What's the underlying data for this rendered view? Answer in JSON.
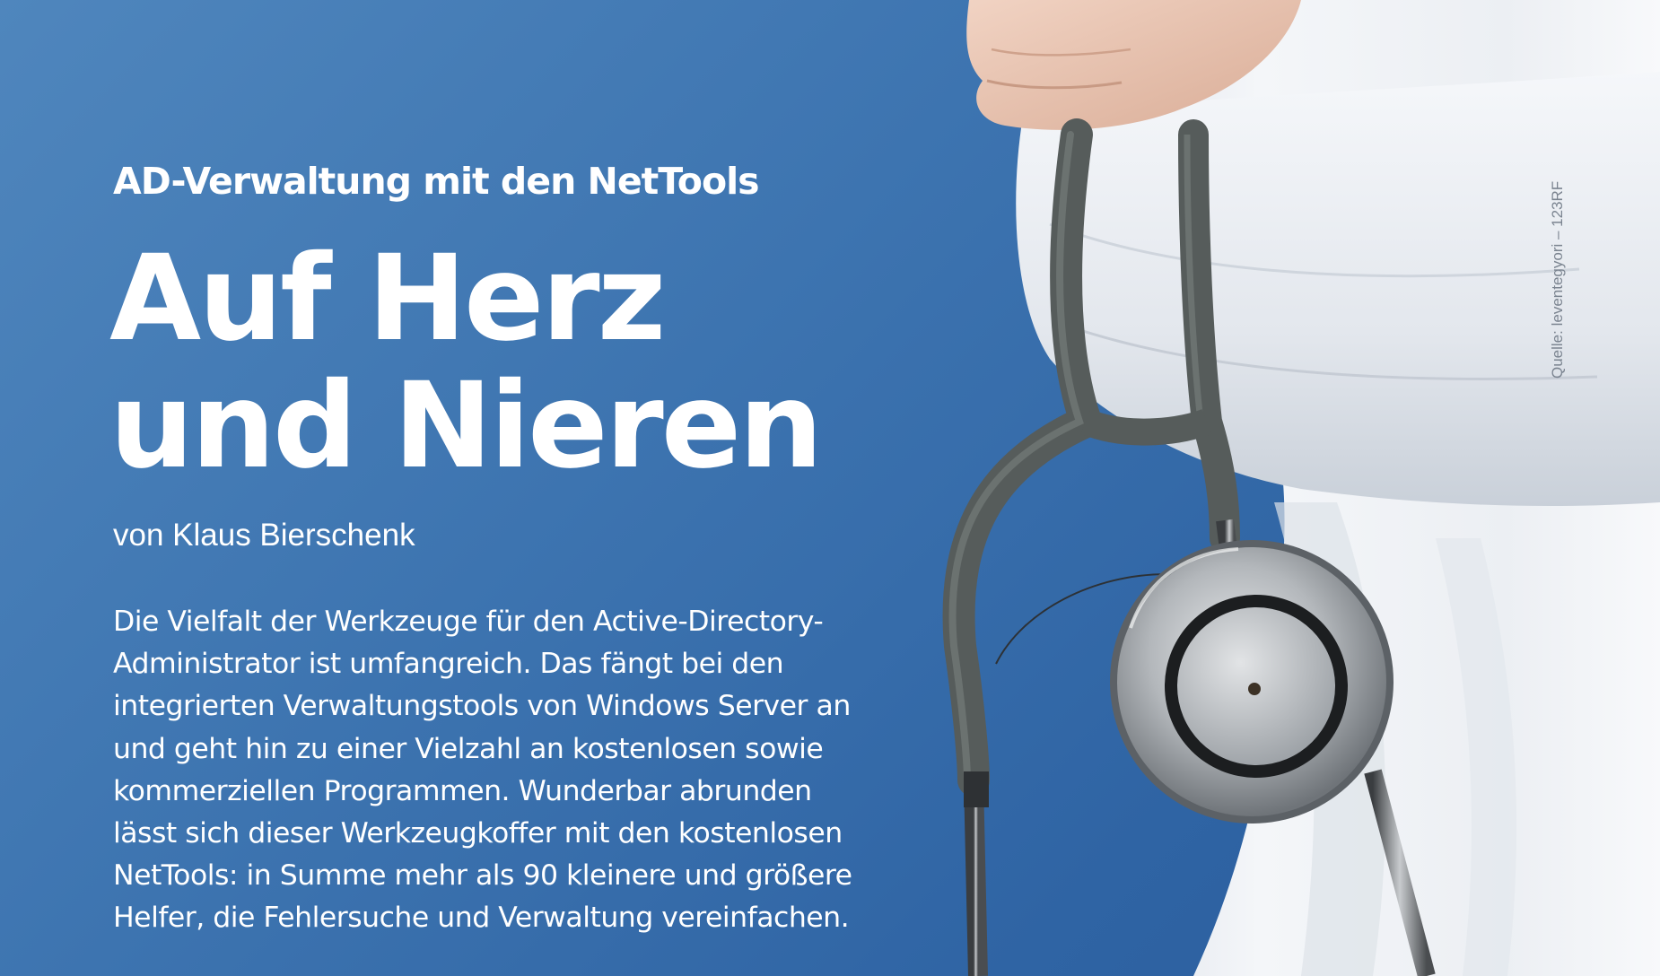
{
  "article": {
    "kicker": "AD-Verwaltung mit den NetTools",
    "headline": [
      "Auf Herz",
      "und Nieren"
    ],
    "byline": "von Klaus Bierschenk",
    "lead_lines": [
      "Die Vielfalt der Werkzeuge für den Active-Directory-",
      "Administrator ist umfangreich. Das fängt bei den",
      "integrierten Verwaltungstools von Windows Server an",
      "und geht hin zu einer Vielzahl an kostenlosen sowie",
      "kommerziellen Programmen. Wunderbar abrunden",
      "lässt sich dieser Werkzeugkoffer mit den kostenlosen",
      "NetTools: in Summe mehr als 90 kleinere und größere",
      "Helfer, die Fehlersuche und Verwaltung vereinfachen."
    ]
  },
  "photo": {
    "credit": "Quelle: leventegyori – 123RF"
  },
  "colors": {
    "background": "#3d74b0",
    "text": "#ffffff",
    "coat": "#eef1f5",
    "tubing": "#555b5a",
    "chestpiece": "#a9adb1"
  }
}
